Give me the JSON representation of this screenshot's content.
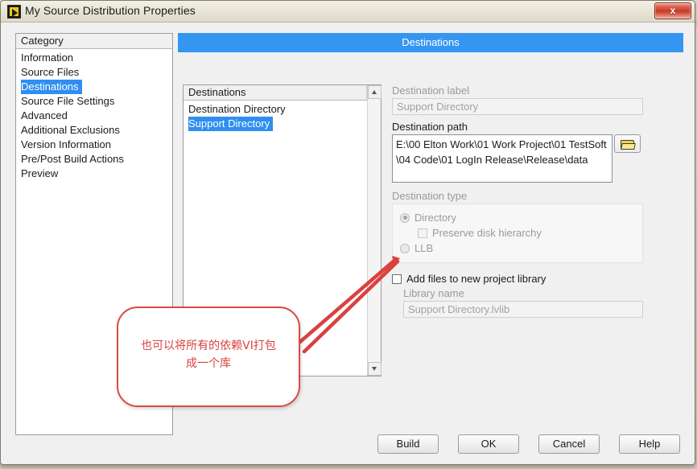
{
  "window": {
    "title": "My Source Distribution Properties",
    "icon": "labview-icon",
    "close_label": "x"
  },
  "category_panel": {
    "header": "Category",
    "items": [
      {
        "label": "Information",
        "selected": false
      },
      {
        "label": "Source Files",
        "selected": false
      },
      {
        "label": "Destinations",
        "selected": true
      },
      {
        "label": "Source File Settings",
        "selected": false
      },
      {
        "label": "Advanced",
        "selected": false
      },
      {
        "label": "Additional Exclusions",
        "selected": false
      },
      {
        "label": "Version Information",
        "selected": false
      },
      {
        "label": "Pre/Post Build Actions",
        "selected": false
      },
      {
        "label": "Preview",
        "selected": false
      }
    ]
  },
  "page": {
    "header": "Destinations"
  },
  "destinations_list": {
    "header": "Destinations",
    "items": [
      {
        "label": "Destination Directory",
        "selected": false
      },
      {
        "label": "Support Directory",
        "selected": true
      }
    ],
    "scroll_up_icon": "triangle-up-icon",
    "scroll_down_icon": "triangle-down-icon"
  },
  "form": {
    "destination_label_title": "Destination label",
    "destination_label_value": "Support Directory",
    "destination_path_title": "Destination path",
    "destination_path_value": "E:\\00 Elton Work\\01 Work Project\\01 TestSoft\\04 Code\\01 LogIn Release\\Release\\data",
    "browse_icon": "folder-icon",
    "destination_type_title": "Destination type",
    "type_directory_label": "Directory",
    "preserve_hierarchy_label": "Preserve disk hierarchy",
    "type_llb_label": "LLB",
    "add_to_library_label": "Add files to new project library",
    "library_name_title": "Library name",
    "library_name_value": "Support Directory.lvlib"
  },
  "buttons": {
    "build": "Build",
    "ok": "OK",
    "cancel": "Cancel",
    "help": "Help"
  },
  "annotation": {
    "text_line1": "也可以将所有的依赖VI打包",
    "text_line2": "成一个库",
    "color": "#d9423f"
  },
  "colors": {
    "accent_blue": "#3596f2",
    "selection_blue": "#2f8ef0",
    "annotation_red": "#d9423f",
    "close_red": "#c63a26",
    "folder_yellow": "#f2d34a"
  }
}
